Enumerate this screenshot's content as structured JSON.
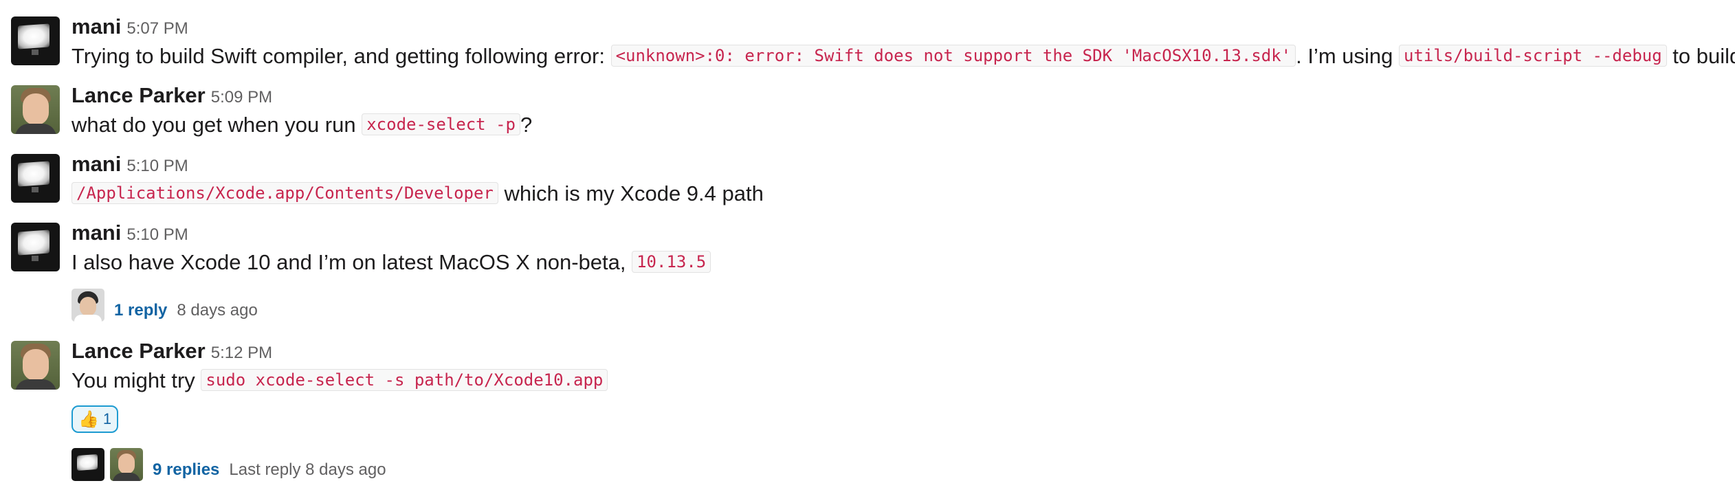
{
  "messages": [
    {
      "author": "mani",
      "time": "5:07 PM",
      "text_1": "Trying to build Swift compiler, and getting following error: ",
      "code_1": "<unknown>:0: error: Swift does not support the SDK 'MacOSX10.13.sdk'",
      "text_2": ". I’m using ",
      "code_2": "utils/build-script --debug",
      "text_3": " to build."
    },
    {
      "author": "Lance Parker",
      "time": "5:09 PM",
      "text_1": "what do you get when you run ",
      "code_1": "xcode-select -p",
      "text_2": "?"
    },
    {
      "author": "mani",
      "time": "5:10 PM",
      "code_1": "/Applications/Xcode.app/Contents/Developer",
      "text_1": " which is my Xcode 9.4 path"
    },
    {
      "author": "mani",
      "time": "5:10 PM",
      "text_1": "I also have Xcode 10 and I’m on latest MacOS X non-beta, ",
      "code_1": "10.13.5",
      "thread": {
        "replies": "1 reply",
        "meta": "8 days ago"
      }
    },
    {
      "author": "Lance Parker",
      "time": "5:12 PM",
      "text_1": "You might try ",
      "code_1": "sudo xcode-select -s path/to/Xcode10.app",
      "reaction": {
        "emoji": "👍",
        "count": "1"
      },
      "thread": {
        "replies": "9 replies",
        "meta": "Last reply 8 days ago"
      }
    }
  ],
  "icons": {
    "avatar_mani": "monitor-avatar-icon",
    "avatar_lance": "person-avatar-icon",
    "reaction": "thumbs-up-icon"
  }
}
